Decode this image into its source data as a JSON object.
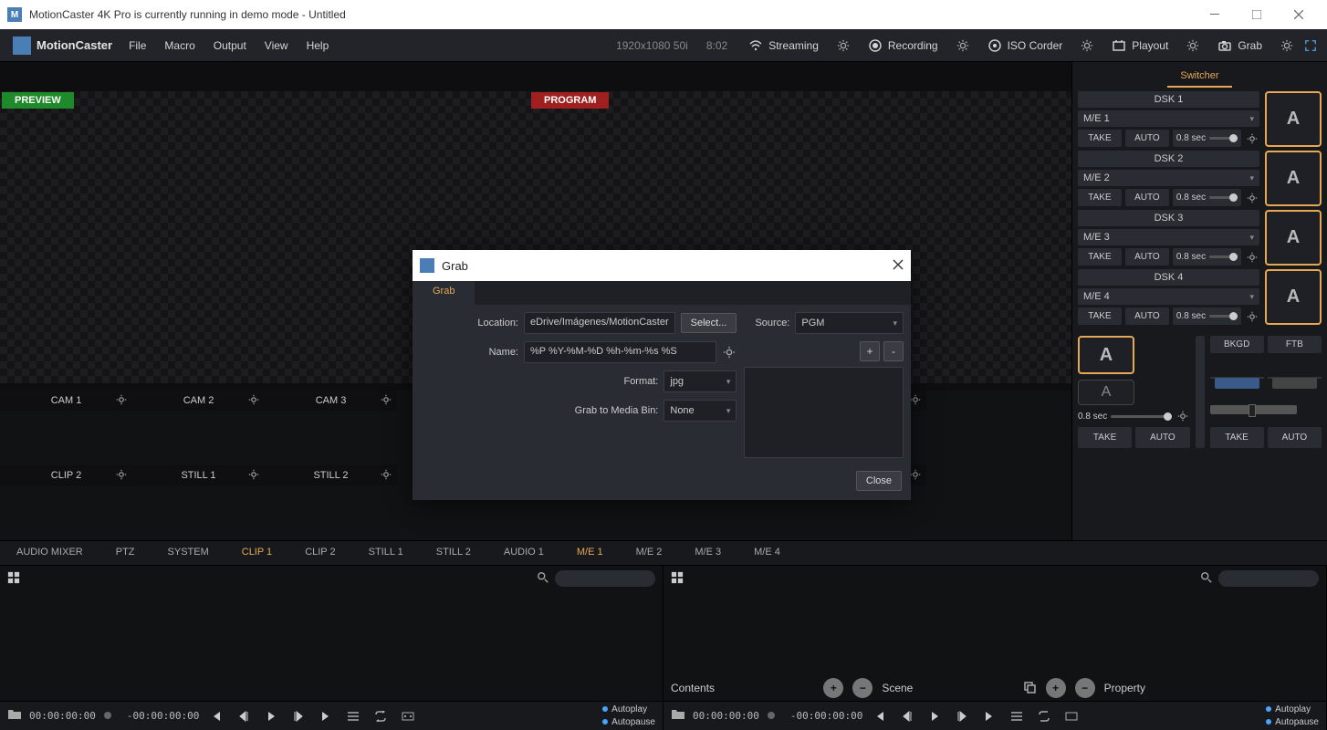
{
  "titlebar": {
    "title": "MotionCaster 4K Pro is currently running in demo mode - Untitled"
  },
  "menubar": {
    "app": "MotionCaster",
    "items": [
      "File",
      "Macro",
      "Output",
      "View",
      "Help"
    ],
    "status_res": "1920x1080 50i",
    "status_time": "8:02",
    "buttons": {
      "streaming": "Streaming",
      "recording": "Recording",
      "iso": "ISO Corder",
      "playout": "Playout",
      "grab": "Grab"
    }
  },
  "video": {
    "preview": "PREVIEW",
    "program": "PROGRAM"
  },
  "sources": {
    "row1": [
      "CAM 1",
      "CAM 2",
      "CAM 3"
    ],
    "row2": [
      "CLIP 2",
      "STILL 1",
      "STILL 2"
    ]
  },
  "switcher": {
    "tab": "Switcher",
    "dsks": [
      {
        "title": "DSK 1",
        "me": "M/E 1",
        "take": "TAKE",
        "auto": "AUTO",
        "sec": "0.8 sec",
        "a": "A"
      },
      {
        "title": "DSK 2",
        "me": "M/E 2",
        "take": "TAKE",
        "auto": "AUTO",
        "sec": "0.8 sec",
        "a": "A"
      },
      {
        "title": "DSK 3",
        "me": "M/E 3",
        "take": "TAKE",
        "auto": "AUTO",
        "sec": "0.8 sec",
        "a": "A"
      },
      {
        "title": "DSK 4",
        "me": "M/E 4",
        "take": "TAKE",
        "auto": "AUTO",
        "sec": "0.8 sec",
        "a": "A"
      }
    ],
    "bottom": {
      "a1": "A",
      "a2": "A",
      "sec": "0.8 sec",
      "take": "TAKE",
      "auto": "AUTO",
      "bkgd": "BKGD",
      "ftb": "FTB"
    }
  },
  "tabs": [
    "AUDIO MIXER",
    "PTZ",
    "SYSTEM",
    "CLIP 1",
    "CLIP 2",
    "STILL 1",
    "STILL 2",
    "AUDIO 1",
    "M/E 1",
    "M/E 2",
    "M/E 3",
    "M/E 4"
  ],
  "tabs_active": [
    3,
    8
  ],
  "lower": {
    "contents": "Contents",
    "scene": "Scene",
    "property": "Property",
    "tc1": "00:00:00:00",
    "tc2": "-00:00:00:00",
    "tc3": "00:00:00:00",
    "tc4": "-00:00:00:00",
    "autoplay": "Autoplay",
    "autopause": "Autopause"
  },
  "dialog": {
    "title": "Grab",
    "tab": "Grab",
    "location_label": "Location:",
    "location_value": "eDrive/Imágenes/MotionCaster",
    "select_btn": "Select...",
    "name_label": "Name:",
    "name_value": "%P %Y-%M-%D %h-%m-%s %S",
    "format_label": "Format:",
    "format_value": "jpg",
    "mediabin_label": "Grab to Media Bin:",
    "mediabin_value": "None",
    "source_label": "Source:",
    "source_value": "PGM",
    "plus": "+",
    "minus": "-",
    "close": "Close"
  }
}
